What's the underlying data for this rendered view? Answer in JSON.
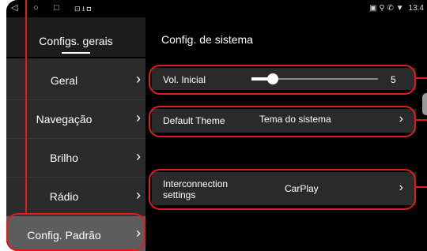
{
  "statusbar": {
    "nav_back": "◁",
    "nav_home": "○",
    "nav_recents": "□",
    "notif_icons": "⊡ ⭳ ◘",
    "right_icons": "▣ ⚲ ✆ ▼",
    "clock": "13:4"
  },
  "sidebar": {
    "title": "Configs. gerais",
    "chevron": "›",
    "items": [
      {
        "label": "Geral"
      },
      {
        "label": "Navegação"
      },
      {
        "label": "Brilho"
      },
      {
        "label": "Rádio"
      },
      {
        "label": "Config. Padrão",
        "active": true
      }
    ]
  },
  "main": {
    "title": "Config. de sistema",
    "vol": {
      "label": "Vol. Inicial",
      "value": "5",
      "level_fraction": 0.17
    },
    "theme": {
      "label": "Default Theme",
      "value": "Tema do sistema"
    },
    "interconnection": {
      "label_line1": "Interconnection",
      "label_line2": "settings",
      "value": "CarPlay"
    }
  },
  "colors": {
    "highlight": "#e01b1b",
    "background": "#000000",
    "sidebar": "#2b2b2b",
    "active_item": "#5d5d5d",
    "row": "#2a2a2a"
  }
}
